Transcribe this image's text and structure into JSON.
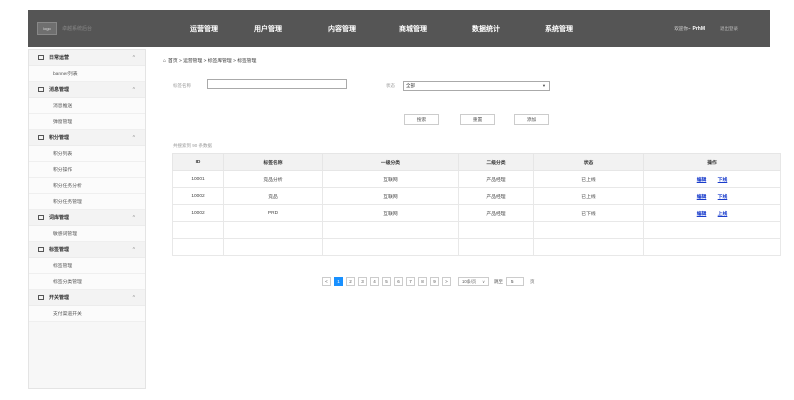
{
  "header": {
    "logo": "logo",
    "system_name": "卓越系统后台",
    "nav": [
      "运营管理",
      "用户管理",
      "内容管理",
      "商城管理",
      "数据统计",
      "系统管理"
    ],
    "welcome": "欢迎你~",
    "user": "PrhM",
    "logout": "退出登录"
  },
  "sidebar": {
    "groups": [
      {
        "label": "日常运营",
        "items": [
          "banner列表"
        ]
      },
      {
        "label": "消息管理",
        "items": [
          "消息推送",
          "弹窗管理"
        ]
      },
      {
        "label": "积分管理",
        "items": [
          "积分列表",
          "积分操作",
          "积分任务分析",
          "积分任务管理"
        ]
      },
      {
        "label": "词库管理",
        "items": [
          "敏感词管理"
        ]
      },
      {
        "label": "标签管理",
        "items": [
          "标签管理",
          "标签分类管理"
        ]
      },
      {
        "label": "开关管理",
        "items": [
          "支付渠道开关"
        ]
      }
    ]
  },
  "breadcrumb": "首页 > 运营管理 > 标签库管理 > 标签管理",
  "filters": {
    "tag_label": "标签名称",
    "tag_value": "",
    "status_label": "状态",
    "status_value": "全部"
  },
  "buttons": {
    "search": "搜索",
    "reset": "重置",
    "add": "添加"
  },
  "result_count": "共搜索到 90 条数据",
  "table": {
    "headers": [
      "ID",
      "标签名称",
      "一级分类",
      "二级分类",
      "状态",
      "操作"
    ],
    "rows": [
      {
        "id": "10001",
        "name": "竞品分析",
        "cat1": "互联网",
        "cat2": "产品经理",
        "status": "已上线",
        "edit": "编辑",
        "toggle": "下线"
      },
      {
        "id": "10002",
        "name": "竞品",
        "cat1": "互联网",
        "cat2": "产品经理",
        "status": "已上线",
        "edit": "编辑",
        "toggle": "下线"
      },
      {
        "id": "10002",
        "name": "PRD",
        "cat1": "互联网",
        "cat2": "产品经理",
        "status": "已下线",
        "edit": "编辑",
        "toggle": "上线"
      }
    ]
  },
  "pagination": {
    "prev": "<",
    "pages": [
      "1",
      "2",
      "3",
      "4",
      "5",
      "6",
      "7",
      "8",
      "9"
    ],
    "current": "1",
    "next": ">",
    "page_size": "10条/页",
    "goto_label": "跳至",
    "goto_value": "5",
    "page_suffix": "页"
  }
}
